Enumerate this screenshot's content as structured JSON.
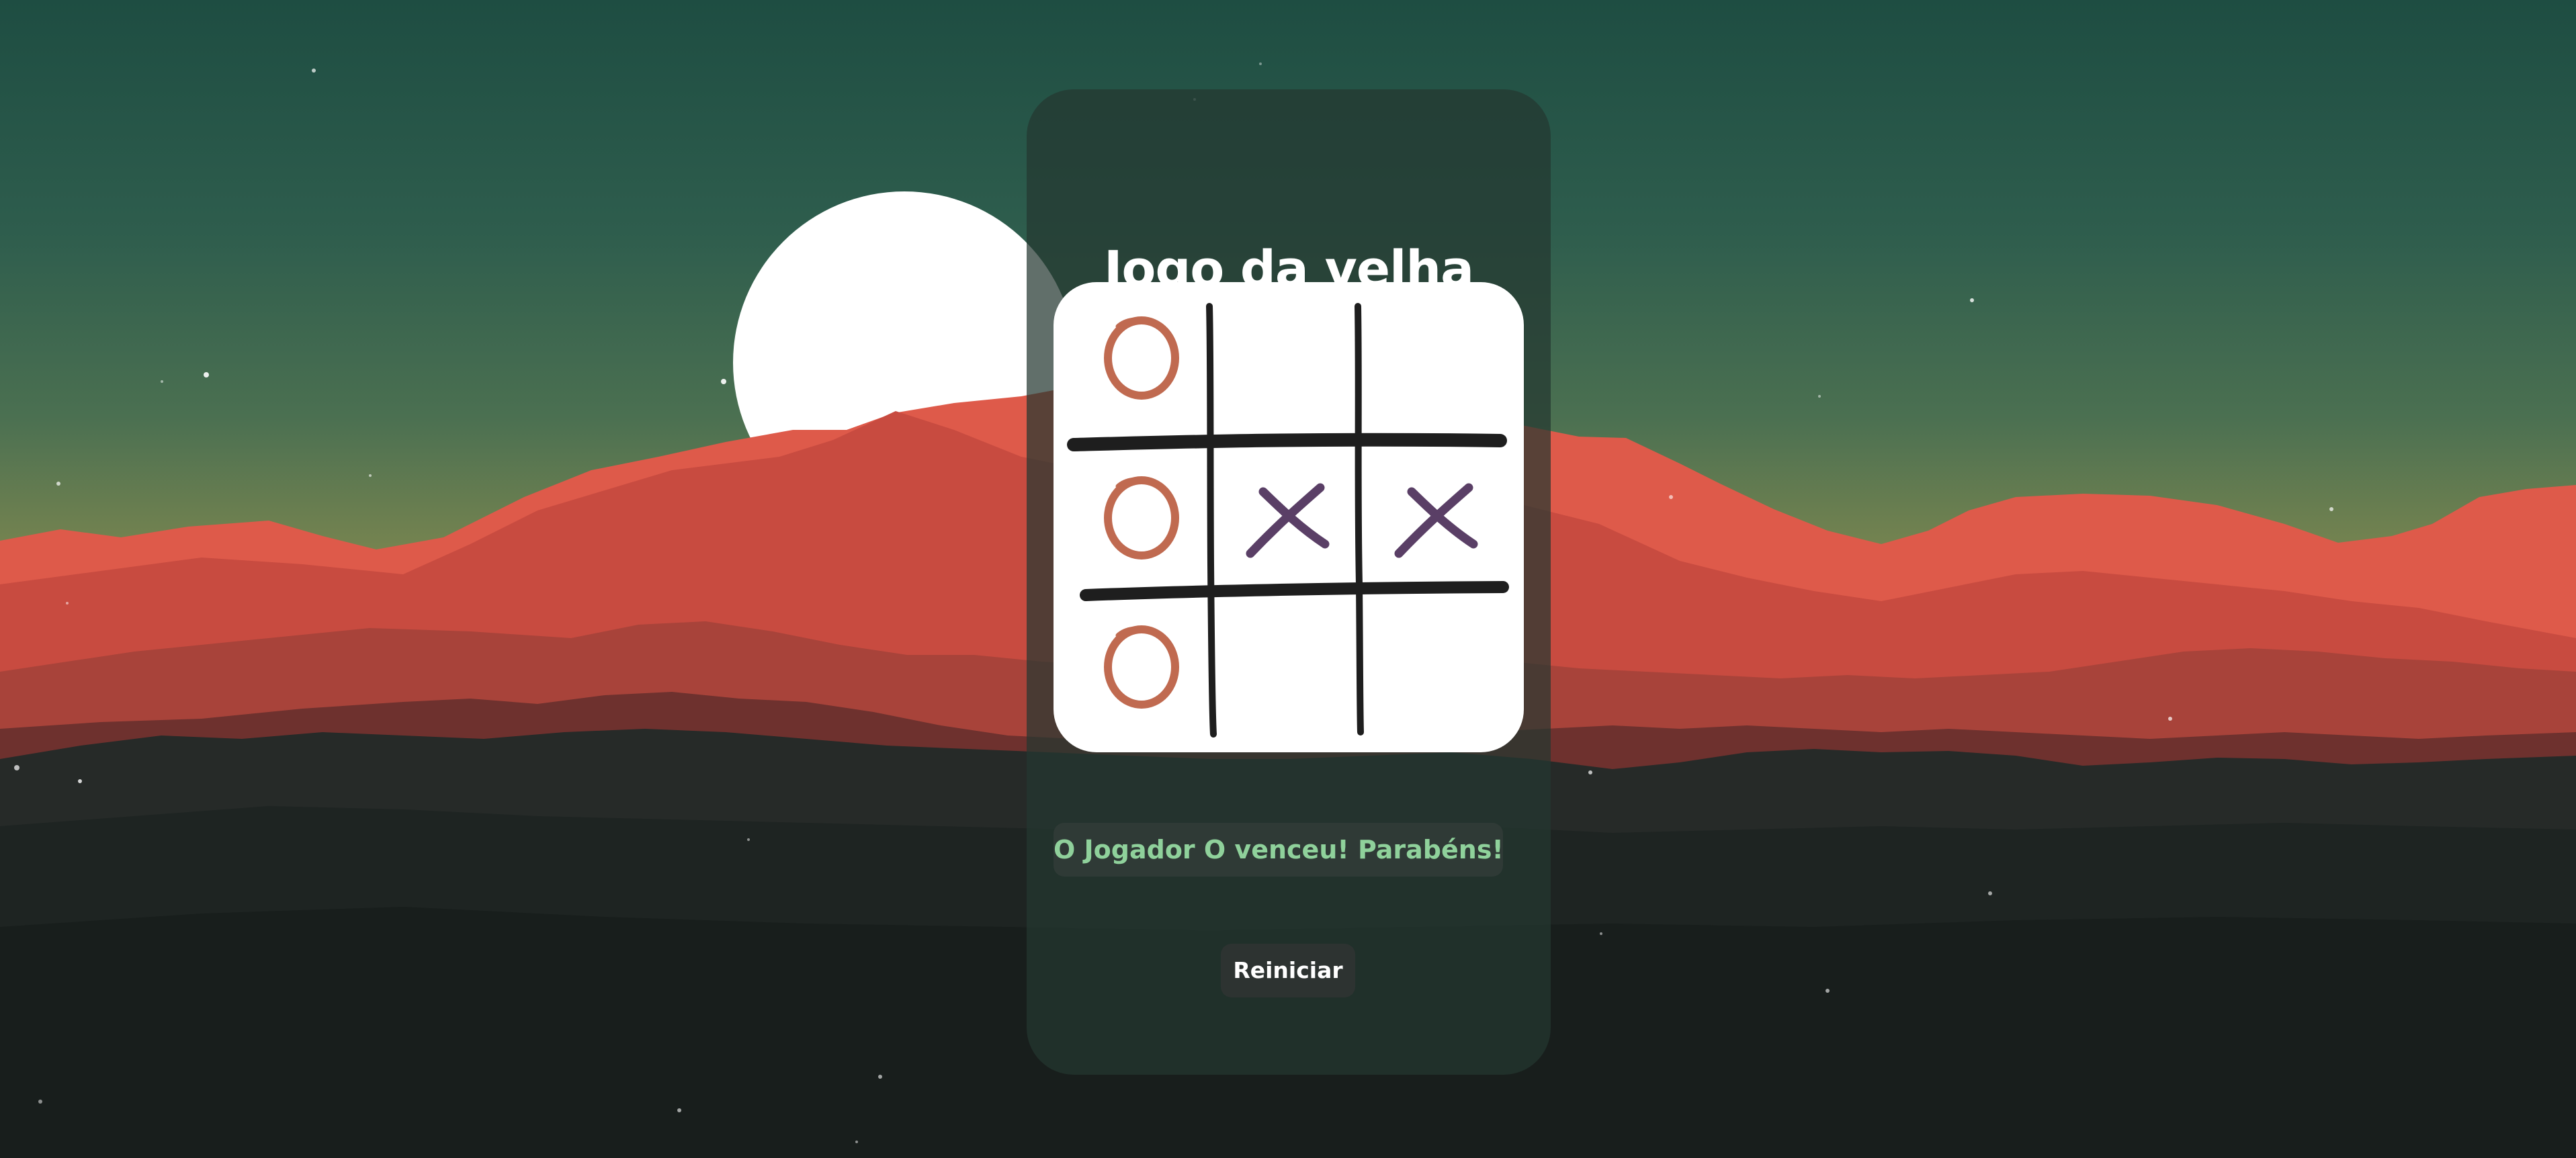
{
  "game": {
    "title": "Jogo da velha",
    "board": [
      [
        "O",
        "",
        ""
      ],
      [
        "O",
        "X",
        "X"
      ],
      [
        "O",
        "",
        ""
      ]
    ],
    "status": "O Jogador O venceu! Parabéns!",
    "restart_label": "Reiniciar"
  },
  "colors": {
    "player_o": "#c06a50",
    "player_x": "#5a3f66",
    "grid": "#1e1e1e",
    "status_text": "#8fd19b"
  }
}
